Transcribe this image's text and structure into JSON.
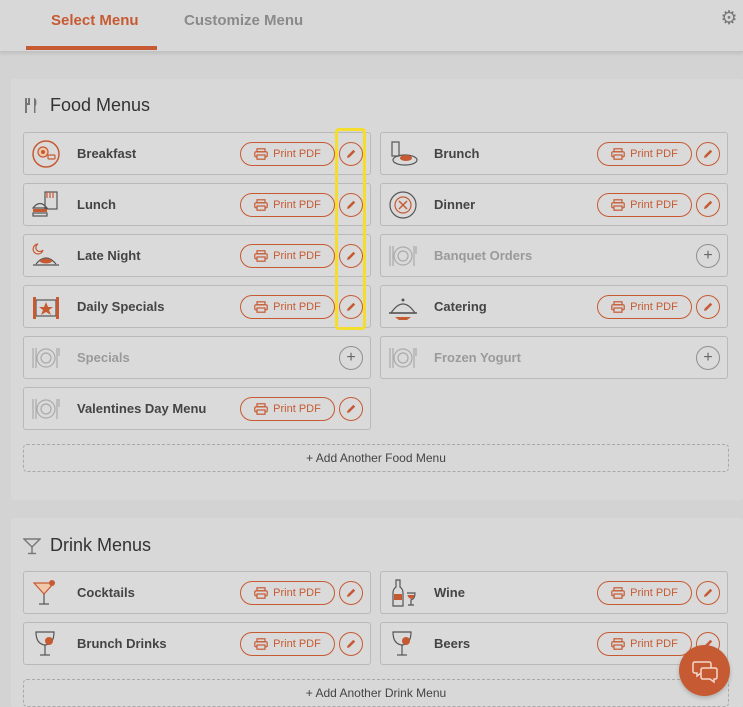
{
  "tabs": [
    {
      "label": "Select Menu",
      "active": true
    },
    {
      "label": "Customize Menu",
      "active": false
    }
  ],
  "colors": {
    "accent": "#c65a33",
    "highlight": "#f4dd2c"
  },
  "food_section": {
    "title": "Food Menus",
    "icon": "fork-knife-icon",
    "add_label": "+ Add Another Food Menu",
    "items": [
      {
        "label": "Breakfast",
        "icon": "breakfast-plate-icon",
        "enabled": true,
        "print_label": "Print PDF"
      },
      {
        "label": "Brunch",
        "icon": "brunch-icon",
        "enabled": true,
        "print_label": "Print PDF"
      },
      {
        "label": "Lunch",
        "icon": "lunch-burger-icon",
        "enabled": true,
        "print_label": "Print PDF"
      },
      {
        "label": "Dinner",
        "icon": "dinner-plate-icon",
        "enabled": true,
        "print_label": "Print PDF"
      },
      {
        "label": "Late Night",
        "icon": "late-night-moon-icon",
        "enabled": true,
        "print_label": "Print PDF"
      },
      {
        "label": "Banquet Orders",
        "icon": "plate-cutlery-icon",
        "enabled": false,
        "print_label": ""
      },
      {
        "label": "Daily Specials",
        "icon": "daily-specials-icon",
        "enabled": true,
        "print_label": "Print PDF"
      },
      {
        "label": "Catering",
        "icon": "catering-cloche-icon",
        "enabled": true,
        "print_label": "Print PDF"
      },
      {
        "label": "Specials",
        "icon": "plate-cutlery-icon",
        "enabled": false,
        "print_label": ""
      },
      {
        "label": "Frozen Yogurt",
        "icon": "plate-cutlery-icon",
        "enabled": false,
        "print_label": ""
      },
      {
        "label": "Valentines Day Menu",
        "icon": "plate-cutlery-icon",
        "enabled": true,
        "print_label": "Print PDF"
      }
    ]
  },
  "drink_section": {
    "title": "Drink Menus",
    "icon": "cocktail-glass-icon",
    "add_label": "+ Add Another Drink Menu",
    "items": [
      {
        "label": "Cocktails",
        "icon": "cocktail-icon",
        "enabled": true,
        "print_label": "Print PDF"
      },
      {
        "label": "Wine",
        "icon": "wine-bottle-icon",
        "enabled": true,
        "print_label": "Print PDF"
      },
      {
        "label": "Brunch Drinks",
        "icon": "brunch-drink-icon",
        "enabled": true,
        "print_label": "Print PDF"
      },
      {
        "label": "Beers",
        "icon": "beer-icon",
        "enabled": true,
        "print_label": "Print PDF"
      }
    ]
  }
}
